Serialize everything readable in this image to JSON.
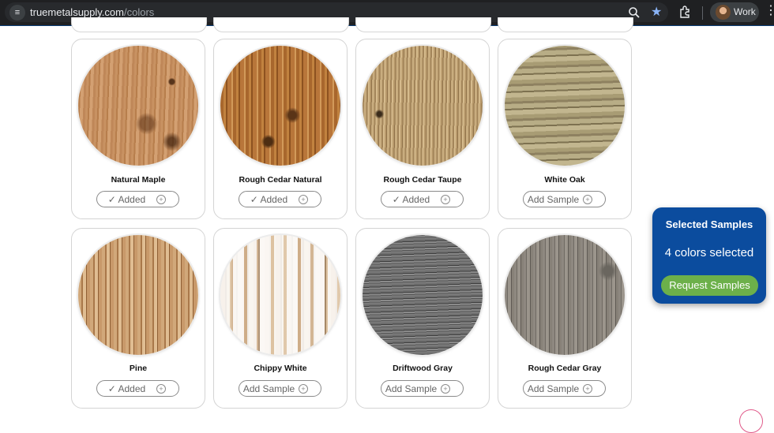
{
  "browser": {
    "url_host": "truemetalsupply.com",
    "url_path": "/colors",
    "profile_name": "Work"
  },
  "colors": [
    {
      "name": "Natural Maple",
      "button": "✓ Added",
      "texture": "t-maple"
    },
    {
      "name": "Rough Cedar Natural",
      "button": "✓ Added",
      "texture": "t-cedar"
    },
    {
      "name": "Rough Cedar Taupe",
      "button": "✓ Added",
      "texture": "t-taupe"
    },
    {
      "name": "White Oak",
      "button": "Add Sample",
      "texture": "t-oak"
    },
    {
      "name": "Pine",
      "button": "✓ Added",
      "texture": "t-pine"
    },
    {
      "name": "Chippy White",
      "button": "Add Sample",
      "texture": "t-chippy"
    },
    {
      "name": "Driftwood Gray",
      "button": "Add Sample",
      "texture": "t-drift"
    },
    {
      "name": "Rough Cedar Gray",
      "button": "Add Sample",
      "texture": "t-rgray"
    }
  ],
  "panel": {
    "title": "Selected Samples",
    "count_text": "4 colors selected",
    "button": "Request Samples"
  },
  "accent_colors": {
    "panel": "#0b4c9e",
    "request_button": "#6cb04a"
  }
}
